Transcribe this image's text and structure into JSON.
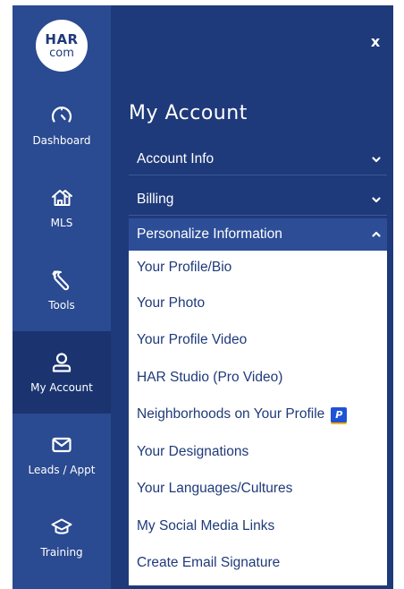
{
  "logo": {
    "line1": "HAR",
    "line2": "com"
  },
  "close_label": "x",
  "rail": [
    {
      "label": "Dashboard",
      "icon": "speedometer-icon"
    },
    {
      "label": "MLS",
      "icon": "houses-icon"
    },
    {
      "label": "Tools",
      "icon": "wrench-icon"
    },
    {
      "label": "My Account",
      "icon": "user-icon",
      "active": true
    },
    {
      "label": "Leads / Appt",
      "icon": "envelope-icon"
    },
    {
      "label": "Training",
      "icon": "graduation-cap-icon"
    }
  ],
  "main": {
    "heading": "My Account",
    "sections": [
      {
        "label": "Account Info",
        "state": "collapsed"
      },
      {
        "label": "Billing",
        "state": "collapsed"
      },
      {
        "label": "Personalize Information",
        "state": "expanded"
      }
    ],
    "submenu": [
      {
        "label": "Your Profile/Bio"
      },
      {
        "label": "Your Photo"
      },
      {
        "label": "Your Profile Video"
      },
      {
        "label": "HAR Studio (Pro Video)"
      },
      {
        "label": "Neighborhoods on Your Profile",
        "badge": "P"
      },
      {
        "label": "Your Designations"
      },
      {
        "label": "Your Languages/Cultures"
      },
      {
        "label": "My Social Media Links"
      },
      {
        "label": "Create Email Signature"
      }
    ]
  },
  "colors": {
    "panel_bg": "#1f3a7a",
    "rail_bg": "#2a4a91",
    "rail_active_bg": "#1b3470",
    "expanded_header_bg": "#2d4e97",
    "submenu_text": "#1f3a7a",
    "pro_badge": "#1e53d6",
    "pro_badge_underline": "#ffb200"
  }
}
